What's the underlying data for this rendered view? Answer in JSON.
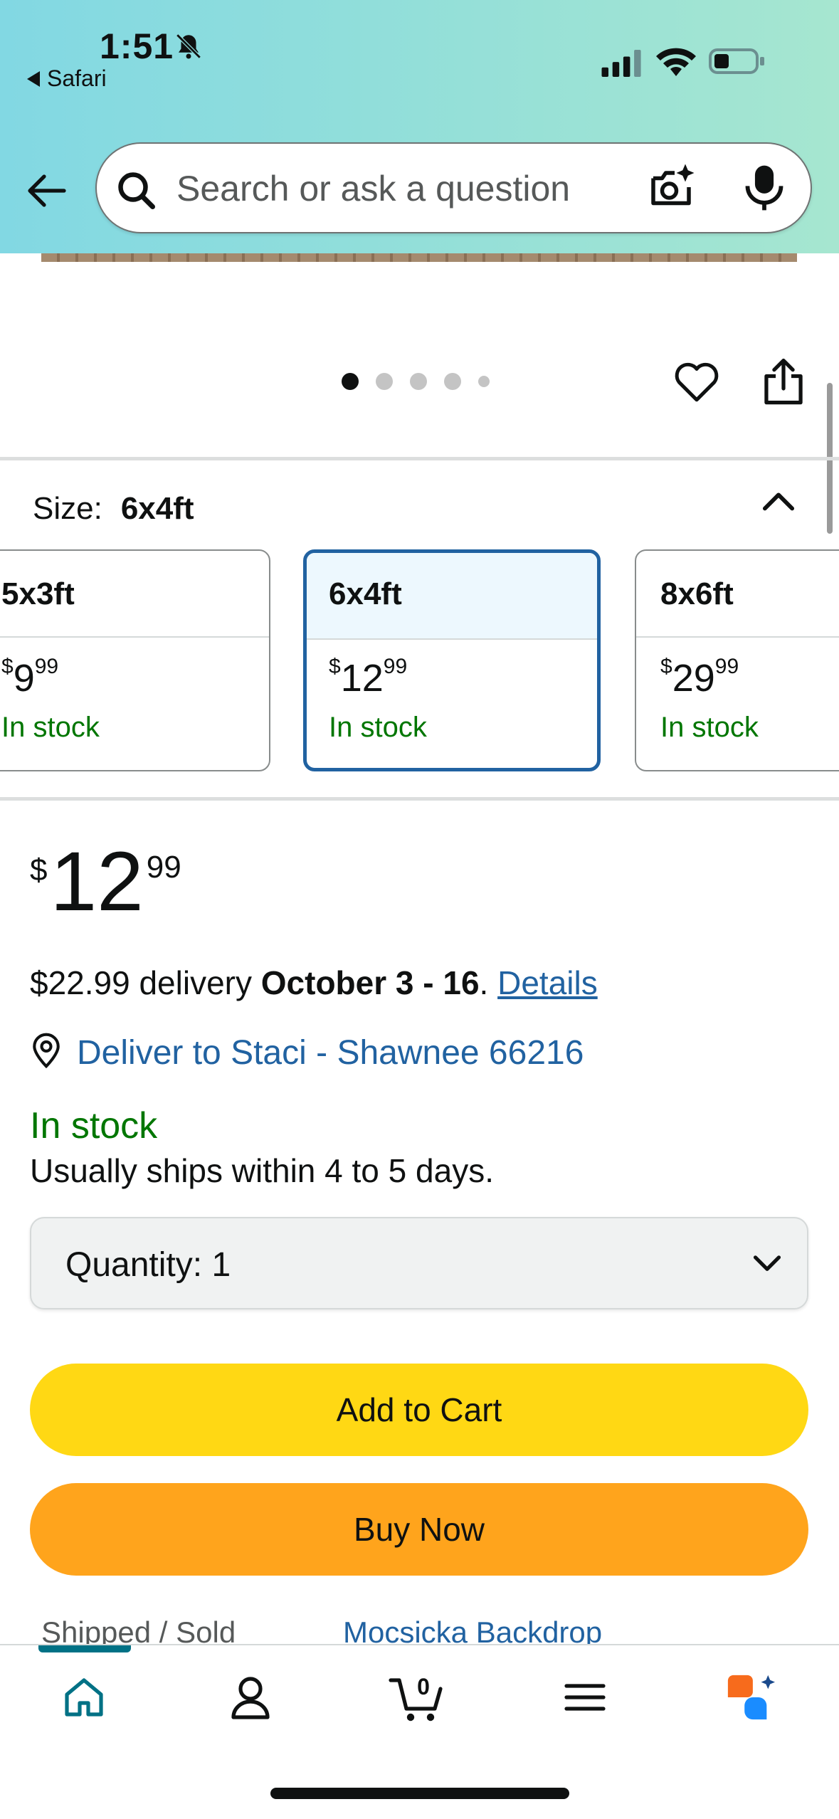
{
  "status_bar": {
    "time": "1:51",
    "back_app": "Safari"
  },
  "search": {
    "placeholder": "Search or ask a question"
  },
  "carousel": {
    "total_images": 5,
    "active_index": 0
  },
  "size": {
    "label": "Size:",
    "selected": "6x4ft",
    "options": [
      {
        "name": "5x3ft",
        "price_whole": "9",
        "price_fraction": "99",
        "stock": "In stock"
      },
      {
        "name": "6x4ft",
        "price_whole": "12",
        "price_fraction": "99",
        "stock": "In stock"
      },
      {
        "name": "8x6ft",
        "price_whole": "29",
        "price_fraction": "99",
        "stock": "In stock"
      }
    ]
  },
  "price": {
    "currency": "$",
    "whole": "12",
    "fraction": "99"
  },
  "delivery": {
    "prefix": "$22.99 delivery ",
    "date": "October 3 - 16",
    "suffix": ". ",
    "details_link": "Details"
  },
  "deliver_to": "Deliver to Staci - Shawnee 66216",
  "availability": "In stock",
  "ships_note": "Usually ships within 4 to 5 days.",
  "quantity": {
    "label": "Quantity:",
    "value": "1"
  },
  "buttons": {
    "add_to_cart": "Add to Cart",
    "buy_now": "Buy Now"
  },
  "seller": {
    "label": "Shipped / Sold",
    "name": "Mocsicka Backdrop"
  },
  "cart_count": "0",
  "colors": {
    "header_start": "#82d8e3",
    "header_end": "#a6e6d0",
    "add_to_cart": "#ffd814",
    "buy_now": "#ffa41c",
    "link": "#2162a1",
    "in_stock": "#007600",
    "nav_active": "#007185"
  },
  "nav": {
    "items": [
      "home-icon",
      "account-icon",
      "cart-icon",
      "menu-icon",
      "rufus-icon"
    ]
  }
}
